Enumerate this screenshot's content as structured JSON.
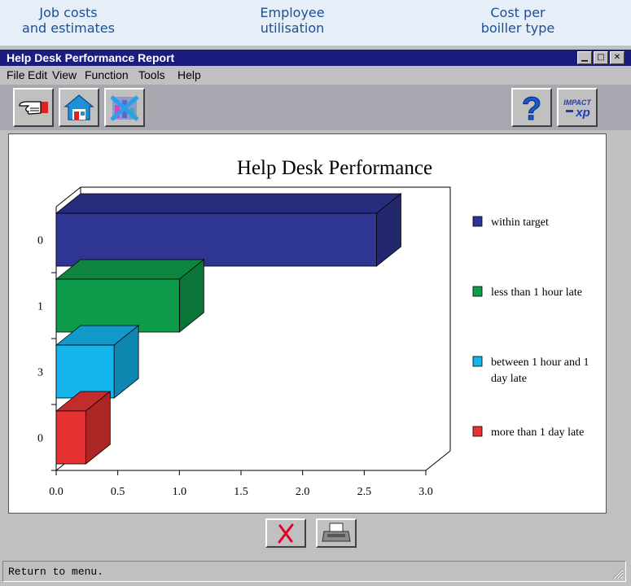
{
  "top_nav": {
    "links": [
      {
        "line1": "Job costs",
        "line2": "and estimates"
      },
      {
        "line1": "Employee",
        "line2": "utilisation"
      },
      {
        "line1": "Cost per",
        "line2": "boiller type"
      }
    ]
  },
  "window": {
    "title": "Help Desk Performance Report",
    "controls": [
      "minimize",
      "maximize",
      "close"
    ]
  },
  "menu": [
    "File",
    "Edit",
    "View",
    "Function",
    "Tools",
    "Help"
  ],
  "toolbar": {
    "buttons": [
      {
        "icon": "pointing-hand-icon"
      },
      {
        "icon": "home-icon"
      },
      {
        "icon": "crossed-out-chart-icon"
      }
    ],
    "right_buttons": [
      {
        "icon": "help-question-icon"
      },
      {
        "icon": "impact-xp-logo-icon",
        "logo_line1": "IMPACT",
        "logo_line2": "xp"
      }
    ]
  },
  "chart_data": {
    "type": "bar",
    "orientation": "horizontal",
    "style": "3d",
    "title": "Help Desk Performance",
    "categories": [
      "0",
      "1",
      "3",
      "0"
    ],
    "values": [
      2.6,
      1.0,
      0.47,
      0.24
    ],
    "series_names": [
      "within target",
      "less than 1 hour late",
      "between 1 hour and 1 day late",
      "more than 1 day late"
    ],
    "colors": [
      "#2e3592",
      "#0f9c4a",
      "#14b4ec",
      "#e63232"
    ],
    "xticks": [
      "0.0",
      "0.5",
      "1.0",
      "1.5",
      "2.0",
      "2.5",
      "3.0"
    ],
    "xlim": [
      0,
      3
    ],
    "legend": [
      {
        "line1": "within target",
        "line2": ""
      },
      {
        "line1": "less than 1 hour late",
        "line2": ""
      },
      {
        "line1": "between 1 hour and 1",
        "line2": "day late"
      },
      {
        "line1": "more than 1 day late",
        "line2": ""
      }
    ],
    "legend_position": "right"
  },
  "bottom_buttons": [
    {
      "icon": "close-x-icon"
    },
    {
      "icon": "printer-icon"
    }
  ],
  "status": {
    "text": "Return to menu."
  }
}
